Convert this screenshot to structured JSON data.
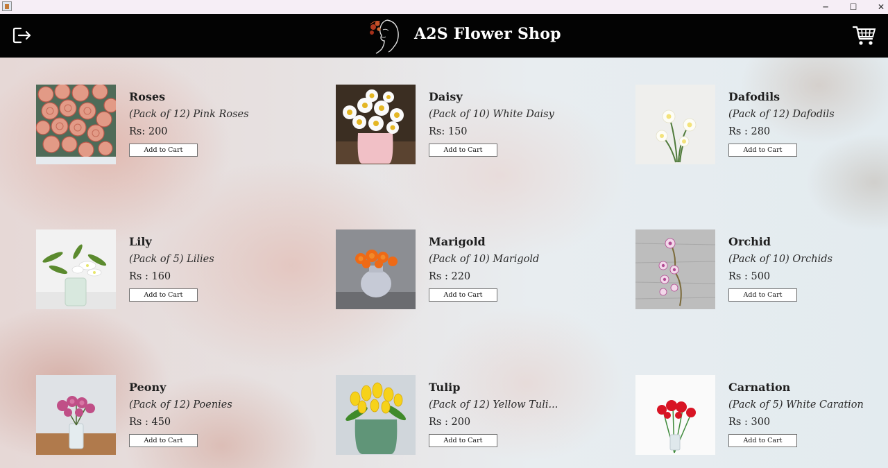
{
  "header": {
    "title": "A2S Flower Shop",
    "logout_icon": "logout-icon",
    "cart_icon": "cart-icon",
    "logo_icon": "floral-woman-logo",
    "background_color": "#030303"
  },
  "window": {
    "minimize_glyph": "─",
    "maximize_glyph": "☐",
    "close_glyph": "✕"
  },
  "products": [
    {
      "name": "Roses",
      "description": "(Pack of 12) Pink Roses",
      "price": "Rs: 200",
      "button": "Add to Cart"
    },
    {
      "name": "Daisy",
      "description": "(Pack of 10) White Daisy",
      "price": "Rs: 150",
      "button": "Add to Cart"
    },
    {
      "name": "Dafodils",
      "description": "(Pack of 12) Dafodils",
      "price": "Rs : 280",
      "button": "Add to Cart"
    },
    {
      "name": "Lily",
      "description": "(Pack of 5) Lilies",
      "price": "Rs : 160",
      "button": "Add to Cart"
    },
    {
      "name": "Marigold",
      "description": "(Pack of 10) Marigold",
      "price": "Rs : 220",
      "button": "Add to Cart"
    },
    {
      "name": "Orchid",
      "description": "(Pack of 10) Orchids",
      "price": "Rs : 500",
      "button": "Add to Cart"
    },
    {
      "name": "Peony",
      "description": "(Pack of 12) Poenies",
      "price": "Rs : 450",
      "button": "Add to Cart"
    },
    {
      "name": "Tulip",
      "description": "(Pack of 12) Yellow Tuli...",
      "price": "Rs : 200",
      "button": "Add to Cart"
    },
    {
      "name": "Carnation",
      "description": "(Pack of 5) White Caration",
      "price": "Rs : 300",
      "button": "Add to Cart"
    }
  ]
}
